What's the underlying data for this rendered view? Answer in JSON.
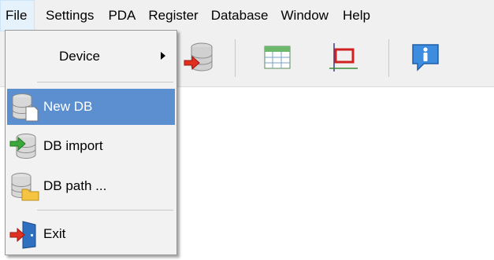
{
  "menubar": {
    "items": [
      {
        "label": "File"
      },
      {
        "label": "Settings"
      },
      {
        "label": "PDA"
      },
      {
        "label": "Register"
      },
      {
        "label": "Database"
      },
      {
        "label": "Window"
      },
      {
        "label": "Help"
      }
    ]
  },
  "file_menu": {
    "items": [
      {
        "label": "Device",
        "icon": "none",
        "submenu": true
      },
      {
        "label": "New DB",
        "icon": "new-database-icon",
        "highlighted": true
      },
      {
        "label": "DB import",
        "icon": "database-import-icon"
      },
      {
        "label": "DB path ...",
        "icon": "database-folder-icon"
      },
      {
        "label": "Exit",
        "icon": "exit-door-icon"
      }
    ]
  },
  "toolbar": {
    "buttons": [
      {
        "icon": "database-import-icon"
      },
      {
        "icon": "table-icon"
      },
      {
        "icon": "frame-range-icon"
      },
      {
        "icon": "info-icon"
      }
    ]
  },
  "colors": {
    "highlight": "#5b8fd0",
    "menu_background": "#f2f2f2",
    "bar_background": "#f0f0f0"
  }
}
